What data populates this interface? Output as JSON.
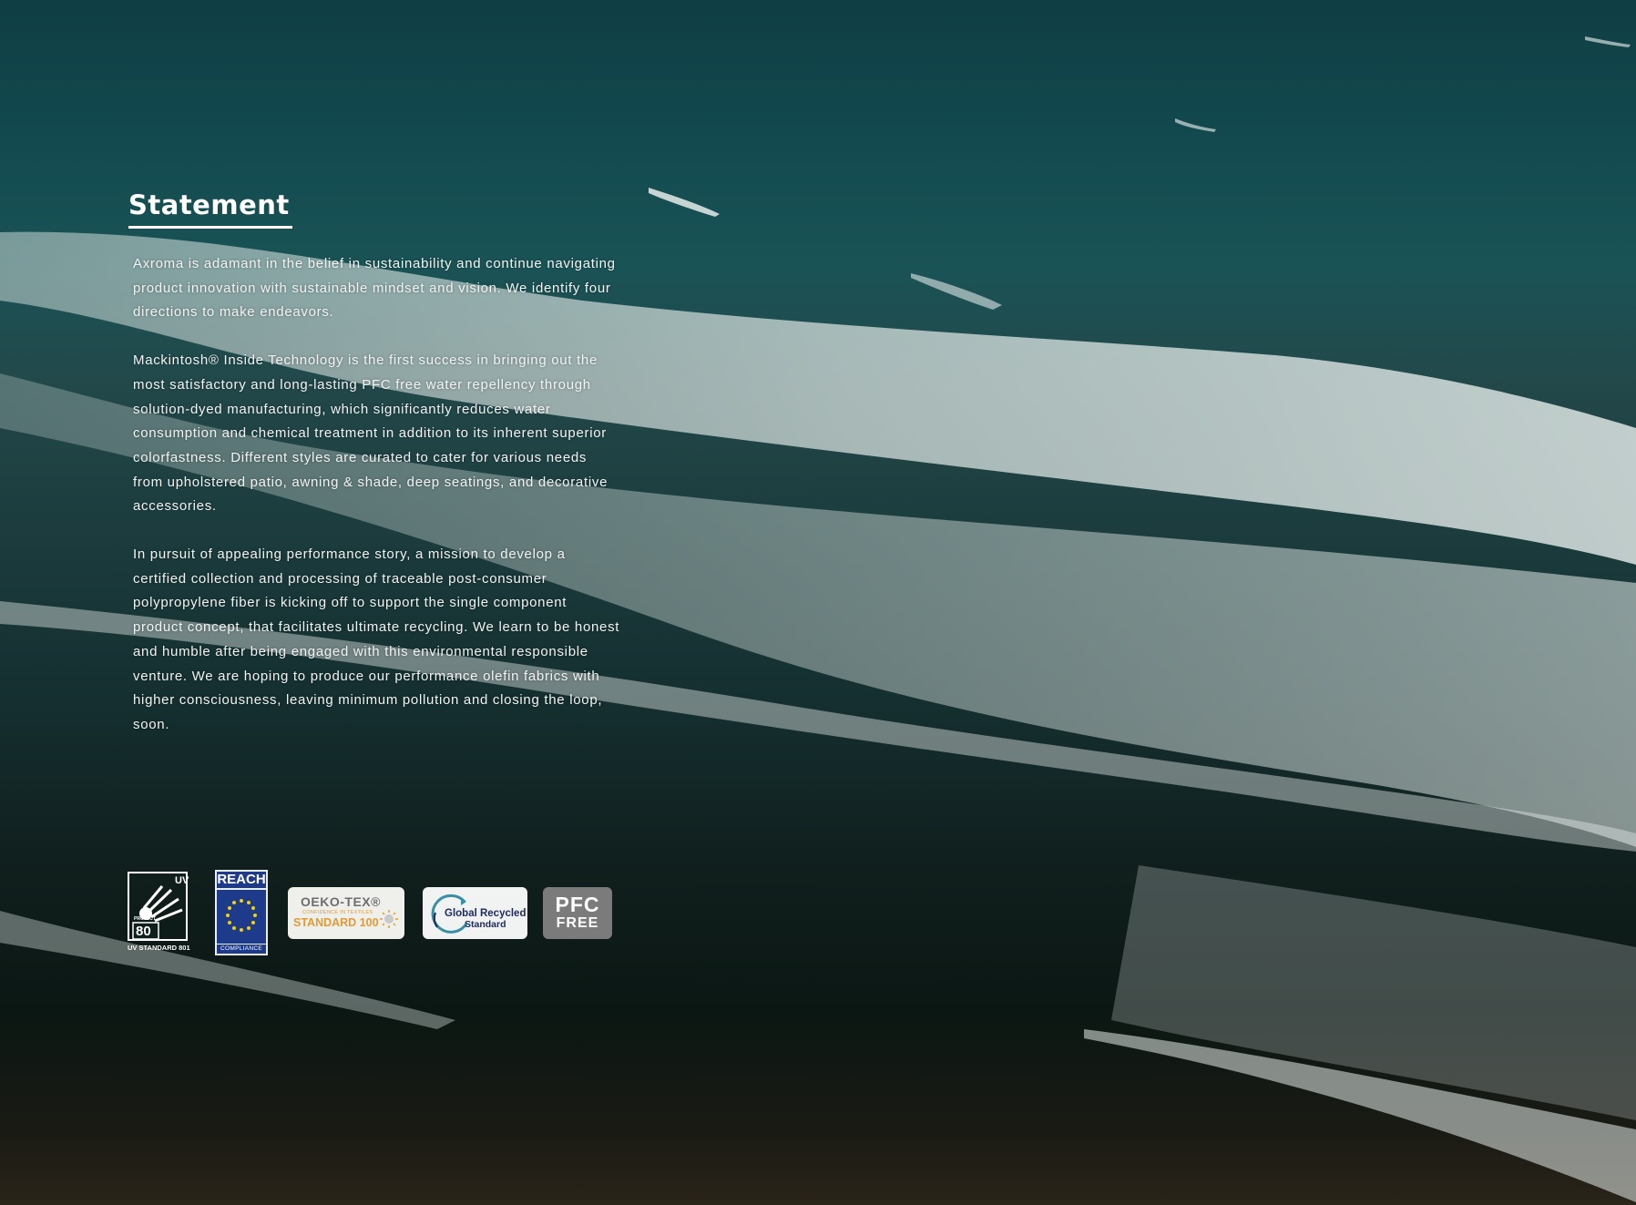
{
  "statement": {
    "title": "Statement",
    "paragraphs": [
      "Axroma is adamant in the belief in sustainability and continue navigating product innovation with sustainable mindset and vision. We identify four directions to make endeavors.",
      "Mackintosh® Inside Technology is the first success in bringing out the most satisfactory and long-lasting PFC free water repellency through solution-dyed manufacturing, which significantly reduces water consumption and chemical treatment in addition to its inherent superior colorfastness. Different styles are curated to cater for various needs from upholstered patio, awning & shade, deep seatings, and decorative accessories.",
      "In pursuit of appealing performance story, a mission to develop a certified collection and processing of traceable post-consumer polypropylene fiber is kicking off to support the single component product concept, that facilitates ultimate recycling. We learn to be honest and humble after being engaged with this environmental responsible venture. We are hoping to produce our performance olefin fabrics with higher consciousness, leaving minimum pollution and closing the loop, soon."
    ]
  },
  "certifications": {
    "uv": {
      "corner": "UV",
      "protect": "PROTECT",
      "value": "80",
      "standard": "UV STANDARD 801"
    },
    "reach": {
      "header": "REACH",
      "footer": "COMPLIANCE"
    },
    "oeko_tex": {
      "brand": "OEKO-TEX®",
      "tagline": "CONFIDENCE IN TEXTILES",
      "standard": "STANDARD 100"
    },
    "grs": {
      "line1": "Global Recycled",
      "line2": "Standard"
    },
    "pfc_free": {
      "line1": "PFC",
      "line2": "FREE"
    }
  },
  "colors": {
    "sea_deep": "#0f3e44",
    "foam": "#d8e2df",
    "sand": "#2a2419",
    "reach_blue": "#1e3a8a",
    "oeko_orange": "#e39a34",
    "pfc_grey": "#7b7b7b"
  }
}
